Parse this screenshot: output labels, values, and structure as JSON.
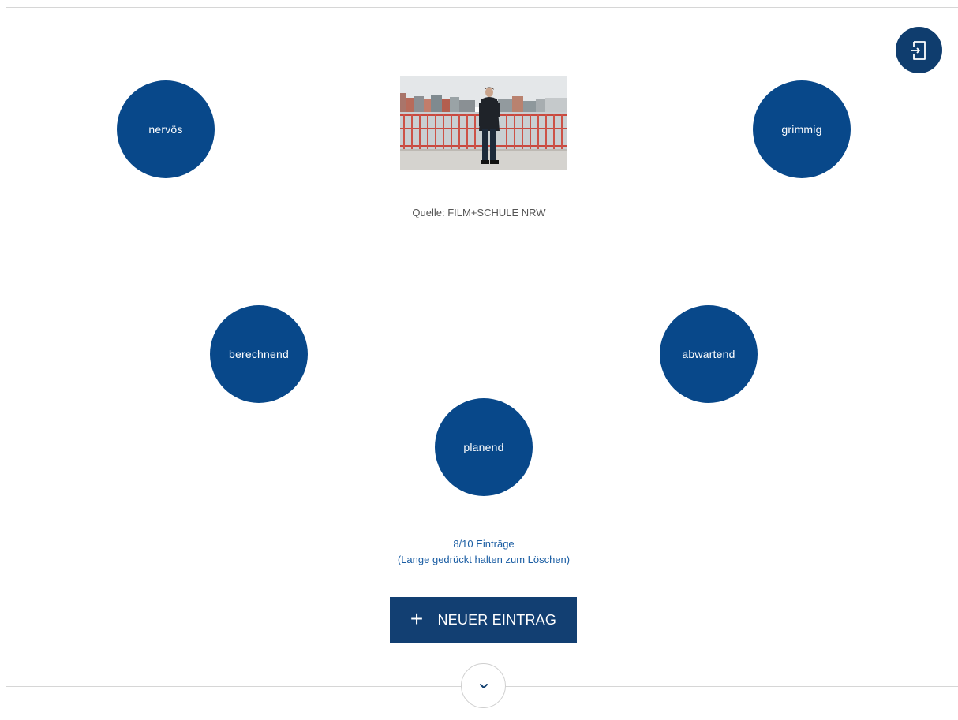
{
  "image": {
    "caption": "Quelle: FILM+SCHULE NRW"
  },
  "entries": [
    {
      "label": "nervös"
    },
    {
      "label": "grimmig"
    },
    {
      "label": "berechnend"
    },
    {
      "label": "abwartend"
    },
    {
      "label": "planend"
    }
  ],
  "status": {
    "count_text": "8/10 Einträge",
    "hint_text": "(Lange gedrückt halten zum Löschen)"
  },
  "new_entry_button": {
    "label": "NEUER EINTRAG",
    "icon": "plus-icon"
  },
  "toolbar": {
    "export_icon": "export-file-icon"
  },
  "scroll": {
    "icon": "chevron-down-icon"
  },
  "colors": {
    "bubble": "#08488a",
    "button": "#123f72",
    "export_button": "#0f3d6e",
    "status_text": "#1a5da3"
  }
}
